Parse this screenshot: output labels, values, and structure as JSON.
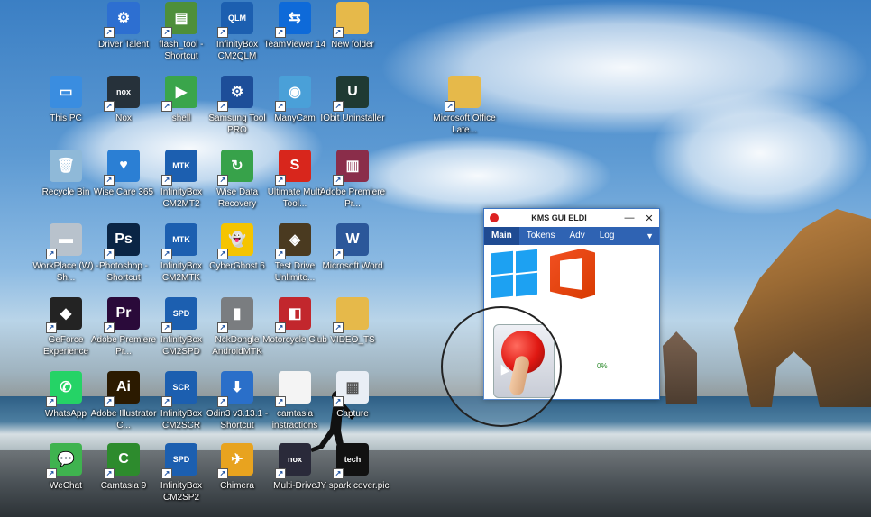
{
  "desktop": {
    "icons": [
      {
        "label": "Driver Talent",
        "icon": "driver-talent-icon",
        "color": "#2d6fd1",
        "glyph": "⚙"
      },
      {
        "label": "flash_tool - Shortcut",
        "icon": "flash-tool-icon",
        "color": "#4e8f3a",
        "glyph": "▤"
      },
      {
        "label": "InfinityBox CM2QLM",
        "icon": "infinitybox-icon",
        "color": "#1c5fb0",
        "glyph": "QLM"
      },
      {
        "label": "TeamViewer 14",
        "icon": "teamviewer-icon",
        "color": "#0e6ad9",
        "glyph": "⇆"
      },
      {
        "label": "New folder",
        "icon": "folder-icon",
        "color": "#e6b94a",
        "glyph": ""
      },
      {
        "label": "This PC",
        "icon": "computer-icon",
        "color": "#3a8de0",
        "glyph": "▭"
      },
      {
        "label": "Nox",
        "icon": "nox-icon",
        "color": "#26313a",
        "glyph": "nox"
      },
      {
        "label": "shell",
        "icon": "shell-icon",
        "color": "#3aa54b",
        "glyph": "▶"
      },
      {
        "label": "Samsung Tool PRO",
        "icon": "samsung-tool-icon",
        "color": "#1d4e99",
        "glyph": "⚙"
      },
      {
        "label": "ManyCam",
        "icon": "manycam-icon",
        "color": "#4aa0d8",
        "glyph": "◉"
      },
      {
        "label": "IObit Uninstaller",
        "icon": "iobit-icon",
        "color": "#1f3a33",
        "glyph": "U"
      },
      {
        "label": "Microsoft Office Late...",
        "icon": "folder-icon",
        "color": "#e6b94a",
        "glyph": ""
      },
      {
        "label": "Recycle Bin",
        "icon": "recycle-bin-icon",
        "color": "#8fb9d8",
        "glyph": "🗑"
      },
      {
        "label": "Wise Care 365",
        "icon": "wise-care-icon",
        "color": "#2b7fd4",
        "glyph": "♥"
      },
      {
        "label": "InfinityBox CM2MT2",
        "icon": "infinitybox-icon",
        "color": "#1c5fb0",
        "glyph": "MTK"
      },
      {
        "label": "Wise Data Recovery",
        "icon": "wise-data-recovery-icon",
        "color": "#37a24a",
        "glyph": "↻"
      },
      {
        "label": "Ultimate Multi Tool...",
        "icon": "ultimate-multi-tool-icon",
        "color": "#d8261c",
        "glyph": "S"
      },
      {
        "label": "Adobe Premiere Pr...",
        "icon": "winrar-icon",
        "color": "#8a2d4a",
        "glyph": "▥"
      },
      {
        "label": "WorkPlace (W) - Sh...",
        "icon": "drive-icon",
        "color": "#b8c2cc",
        "glyph": "▬"
      },
      {
        "label": "Photoshop - Shortcut",
        "icon": "photoshop-icon",
        "color": "#0a2545",
        "glyph": "Ps"
      },
      {
        "label": "InfinityBox CM2MTK",
        "icon": "infinitybox-icon",
        "color": "#1c5fb0",
        "glyph": "MTK"
      },
      {
        "label": "CyberGhost 6",
        "icon": "cyberghost-icon",
        "color": "#f5c400",
        "glyph": "👻"
      },
      {
        "label": "Test Drive Unlimite...",
        "icon": "test-drive-icon",
        "color": "#4a3a20",
        "glyph": "◈"
      },
      {
        "label": "Microsoft Word",
        "icon": "word-icon",
        "color": "#2b579a",
        "glyph": "W"
      },
      {
        "label": "GeForce Experience",
        "icon": "geforce-icon",
        "color": "#232323",
        "glyph": "◆"
      },
      {
        "label": "Adobe Premiere Pr...",
        "icon": "premiere-icon",
        "color": "#2a0a3a",
        "glyph": "Pr"
      },
      {
        "label": "InfinityBox CM2SPD",
        "icon": "infinitybox-icon",
        "color": "#1c5fb0",
        "glyph": "SPD"
      },
      {
        "label": "NckDongle AndroidMTK",
        "icon": "nckdongle-icon",
        "color": "#7a7d80",
        "glyph": "▮"
      },
      {
        "label": "Motorcycle Club",
        "icon": "motorcycle-club-icon",
        "color": "#c2272d",
        "glyph": "◧"
      },
      {
        "label": "VIDEO_TS",
        "icon": "folder-icon",
        "color": "#e6b94a",
        "glyph": ""
      },
      {
        "label": "WhatsApp",
        "icon": "whatsapp-icon",
        "color": "#25d366",
        "glyph": "✆"
      },
      {
        "label": "Adobe Illustrator C...",
        "icon": "illustrator-icon",
        "color": "#2b1a00",
        "glyph": "Ai"
      },
      {
        "label": "InfinityBox CM2SCR",
        "icon": "infinitybox-icon",
        "color": "#1c5fb0",
        "glyph": "SCR"
      },
      {
        "label": "Odin3 v3.13.1 - Shortcut",
        "icon": "odin-icon",
        "color": "#2a6fc9",
        "glyph": "⬇"
      },
      {
        "label": "camtasia instractions",
        "icon": "document-icon",
        "color": "#f4f4f4",
        "glyph": ""
      },
      {
        "label": "Capture",
        "icon": "capture-icon",
        "color": "#e9eef5",
        "glyph": "▦"
      },
      {
        "label": "WeChat",
        "icon": "wechat-icon",
        "color": "#3fb34f",
        "glyph": "💬"
      },
      {
        "label": "Camtasia 9",
        "icon": "camtasia-icon",
        "color": "#2d8b2d",
        "glyph": "C"
      },
      {
        "label": "InfinityBox CM2SP2",
        "icon": "infinitybox-icon",
        "color": "#1c5fb0",
        "glyph": "SPD"
      },
      {
        "label": "Chimera",
        "icon": "chimera-icon",
        "color": "#e8a31f",
        "glyph": "✈"
      },
      {
        "label": "Multi-Drive",
        "icon": "multi-drive-icon",
        "color": "#2a2a3a",
        "glyph": "nox"
      },
      {
        "label": "JY spark cover.pic",
        "icon": "image-icon",
        "color": "#111",
        "glyph": "tech"
      }
    ]
  },
  "kms_window": {
    "title": "KMS GUI ELDI",
    "minimize": "—",
    "close": "✕",
    "tabs": [
      "Main",
      "Tokens",
      "Adv",
      "Log"
    ],
    "dropdown": "▼",
    "progress_text": "0%"
  }
}
